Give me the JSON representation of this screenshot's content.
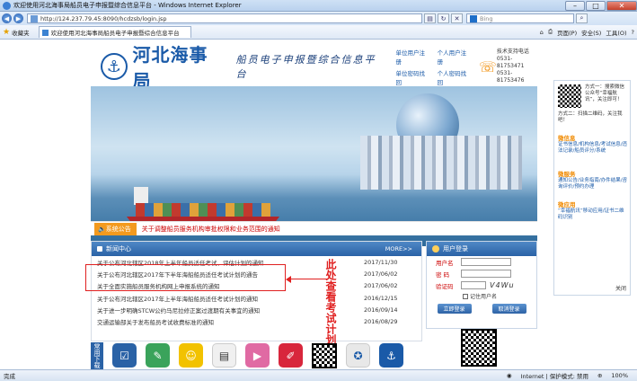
{
  "window": {
    "title": "欢迎使用河北海事局船员电子申报暨综合信息平台 - Windows Internet Explorer"
  },
  "addressbar": {
    "url": "http://124.237.79.45:8090/hcdzsb/login.jsp",
    "search_placeholder": "Bing"
  },
  "favbar": {
    "favorites_label": "收藏夹",
    "tab_title": "欢迎使用河北海事局船员电子申报暨综合信息平台",
    "tools": [
      "页面(P)",
      "安全(S)",
      "工具(O)"
    ]
  },
  "header": {
    "brand": "河北海事局",
    "subtitle": "船员电子申报暨综合信息平台",
    "links": [
      "单位用户注册",
      "个人用户注册",
      "单位密码找回",
      "个人密码找回"
    ],
    "support_title": "技术支持电话",
    "support_lines": [
      "0531-81753471",
      "0531-81753476"
    ]
  },
  "notice": {
    "tag": "系统公告",
    "text": "关于调整船员服务机构审批权限和业务范围的通知"
  },
  "news": {
    "title": "新闻中心",
    "more": "MORE>>",
    "items": [
      {
        "title": "关于公布河北辖区2018年上半年船员适任考试、评估计划的通知",
        "date": "2017/11/30"
      },
      {
        "title": "关于公布河北辖区2017年下半年海船船员适任考试计划的通告",
        "date": "2017/06/02"
      },
      {
        "title": "关于全面实施船员服务机构网上申报系统的通知",
        "date": "2017/06/02"
      },
      {
        "title": "关于公布河北辖区2017年上半年海船船员适任考试计划的通知",
        "date": "2016/12/15"
      },
      {
        "title": "关于进一步明确STCW公约马尼拉修正案过渡期有关事宜的通知",
        "date": "2016/09/14"
      },
      {
        "title": "交通运输部关于发布船员考试收费标准的通知",
        "date": "2016/08/29"
      }
    ]
  },
  "annotation": {
    "text": "此处查看考试计划"
  },
  "login": {
    "title": "用户登录",
    "username_label": "用户名",
    "password_label": "密 码",
    "captcha_label": "验证码",
    "captcha_value": "V4Wu",
    "remember_label": "记住用户名",
    "login_button": "立即登录",
    "cancel_button": "取消登录"
  },
  "quick": {
    "label": "常用下载"
  },
  "side": {
    "qr_text": "方式一：搜索微信公众号“幸福航讯”，关注即可！",
    "hl1": "方式二：扫描二维码，关注我吧！",
    "weixin_title": "微信息",
    "weixin_items": "证书信息/机构信息/考试信息/违法记录/船员评分/系统",
    "service_title": "微服务",
    "service_items": "通知公告/业务指南/办件结果/咨询评价/预约办理",
    "app_title": "微应用",
    "app_items": "“幸福航讯”移动应用/证书二维码识别",
    "close": "关闭"
  },
  "statusbar": {
    "left": "完成",
    "zone": "Internet | 保护模式: 禁用",
    "zoom": "100%"
  }
}
